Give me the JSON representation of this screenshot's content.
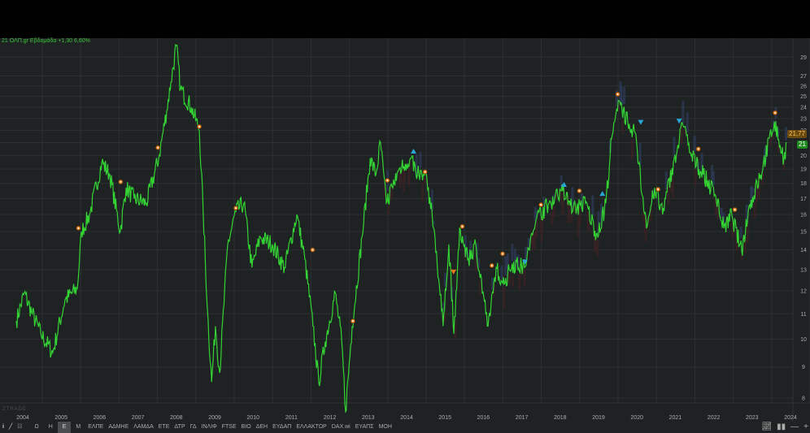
{
  "legend": {
    "text": "21 ΟΛΠ.gr Εβδομάδα +1,30 6,60%"
  },
  "watermark": "ZTRADE",
  "price_tags": {
    "last_close": "21,77",
    "current": "21"
  },
  "toolbar": {
    "tools": [
      "i-icon",
      "line-tool-icon",
      "grid-icon"
    ],
    "intervals": [
      "Ω",
      "Η",
      "Ε",
      "Μ"
    ],
    "active_interval": "Ε",
    "symbols": [
      "ΕΛΠΕ",
      "ΑΔΜΗΕ",
      "ΛΑΜΔΑ",
      "ΕΤΕ",
      "ΔΤΡ",
      "ΓΔ",
      "ΙΝΛΙΦ",
      "FTSE",
      "ΒΙΟ",
      "ΔΕΗ",
      "ΕΥΔΑΠ",
      "ΕΛΛΑΚΤΩΡ",
      "DAX.wi",
      "ΕΥΑΠΣ",
      "ΜΟΗ"
    ],
    "right": [
      "indicators-icon",
      "volume-icon",
      "zoom-out-icon",
      "zoom-in-icon"
    ]
  },
  "colors": {
    "line": "#33d433",
    "grid": "#2f3334",
    "bg": "#1f2223",
    "marker_orange": "#e07b1f",
    "marker_blue": "#2aa6d6"
  },
  "chart_data": {
    "type": "line",
    "title": "ΟΛΠ.gr Εβδομάδα",
    "xlabel": "",
    "ylabel": "",
    "y_scale": "log",
    "ylim": [
      7.3,
      31
    ],
    "xlim": [
      2003.65,
      2024.15
    ],
    "x_ticks": [
      "2004",
      "2005",
      "2006",
      "2007",
      "2008",
      "2009",
      "2010",
      "2011",
      "2012",
      "2013",
      "2014",
      "2015",
      "2016",
      "2017",
      "2018",
      "2019",
      "2020",
      "2021",
      "2022",
      "2023",
      "2024"
    ],
    "y_ticks": [
      8,
      9,
      10,
      11,
      12,
      13,
      14,
      15,
      16,
      17,
      18,
      19,
      20,
      21,
      22,
      23,
      24,
      25,
      26,
      27,
      29
    ],
    "grid": true,
    "series": [
      {
        "name": "ΟΛΠ",
        "points": [
          [
            2003.83,
            10.7
          ],
          [
            2004.04,
            11.9
          ],
          [
            2004.25,
            11.0
          ],
          [
            2004.47,
            10.2
          ],
          [
            2004.78,
            9.5
          ],
          [
            2005.1,
            11.6
          ],
          [
            2005.42,
            12.1
          ],
          [
            2005.53,
            15
          ],
          [
            2005.74,
            16
          ],
          [
            2006.06,
            19.5
          ],
          [
            2006.27,
            18.6
          ],
          [
            2006.54,
            15
          ],
          [
            2006.69,
            17.7
          ],
          [
            2006.9,
            17
          ],
          [
            2007.22,
            16.7
          ],
          [
            2007.54,
            19.8
          ],
          [
            2007.75,
            23.7
          ],
          [
            2007.86,
            26.4
          ],
          [
            2008.0,
            30.3
          ],
          [
            2008.11,
            25.7
          ],
          [
            2008.39,
            24
          ],
          [
            2008.6,
            22
          ],
          [
            2008.7,
            16.2
          ],
          [
            2008.81,
            11.2
          ],
          [
            2008.92,
            8.5
          ],
          [
            2009.02,
            10.5
          ],
          [
            2009.13,
            8.8
          ],
          [
            2009.34,
            14.3
          ],
          [
            2009.55,
            16.2
          ],
          [
            2009.76,
            16.7
          ],
          [
            2009.97,
            13.1
          ],
          [
            2010.19,
            14.7
          ],
          [
            2010.5,
            14.3
          ],
          [
            2010.82,
            13.1
          ],
          [
            2011.14,
            16
          ],
          [
            2011.35,
            13.5
          ],
          [
            2011.56,
            10.5
          ],
          [
            2011.71,
            8.5
          ],
          [
            2011.88,
            9.9
          ],
          [
            2012.14,
            11.9
          ],
          [
            2012.31,
            9.9
          ],
          [
            2012.41,
            7.6
          ],
          [
            2012.58,
            10.5
          ],
          [
            2012.84,
            14.7
          ],
          [
            2013.05,
            19.8
          ],
          [
            2013.2,
            18.6
          ],
          [
            2013.32,
            21
          ],
          [
            2013.47,
            16.7
          ],
          [
            2013.79,
            18.9
          ],
          [
            2014.1,
            19.8
          ],
          [
            2014.32,
            18.6
          ],
          [
            2014.53,
            18.3
          ],
          [
            2014.74,
            14.7
          ],
          [
            2014.95,
            10.5
          ],
          [
            2015.1,
            14.3
          ],
          [
            2015.23,
            10.2
          ],
          [
            2015.38,
            15.2
          ],
          [
            2015.59,
            13.5
          ],
          [
            2015.8,
            14.3
          ],
          [
            2016.12,
            10.5
          ],
          [
            2016.33,
            13.1
          ],
          [
            2016.54,
            12.3
          ],
          [
            2016.75,
            13.3
          ],
          [
            2017.07,
            13.1
          ],
          [
            2017.39,
            15.8
          ],
          [
            2017.71,
            16.7
          ],
          [
            2018.03,
            17.5
          ],
          [
            2018.34,
            16.4
          ],
          [
            2018.66,
            16.7
          ],
          [
            2018.98,
            14.7
          ],
          [
            2019.19,
            16.7
          ],
          [
            2019.34,
            21.3
          ],
          [
            2019.55,
            24.5
          ],
          [
            2019.76,
            22.7
          ],
          [
            2019.97,
            21.7
          ],
          [
            2020.14,
            17.2
          ],
          [
            2020.25,
            15.2
          ],
          [
            2020.46,
            17.7
          ],
          [
            2020.67,
            16
          ],
          [
            2020.95,
            19.5
          ],
          [
            2021.2,
            22.4
          ],
          [
            2021.41,
            20
          ],
          [
            2021.73,
            18.6
          ],
          [
            2022.05,
            17.2
          ],
          [
            2022.26,
            15.2
          ],
          [
            2022.47,
            16
          ],
          [
            2022.73,
            13.9
          ],
          [
            2022.9,
            16.2
          ],
          [
            2023.22,
            18.6
          ],
          [
            2023.58,
            22.7
          ],
          [
            2023.73,
            20.8
          ],
          [
            2023.83,
            19.8
          ],
          [
            2023.9,
            21
          ]
        ]
      }
    ],
    "markers": [
      {
        "type": "circle",
        "x": 2005.45,
        "y": 15.2
      },
      {
        "type": "circle",
        "x": 2006.55,
        "y": 18.1
      },
      {
        "type": "circle",
        "x": 2007.52,
        "y": 20.6
      },
      {
        "type": "circle",
        "x": 2008.6,
        "y": 22.3
      },
      {
        "type": "circle",
        "x": 2009.55,
        "y": 16.4
      },
      {
        "type": "circle",
        "x": 2011.55,
        "y": 14
      },
      {
        "type": "circle",
        "x": 2012.6,
        "y": 10.7
      },
      {
        "type": "circle",
        "x": 2013.5,
        "y": 18.2
      },
      {
        "type": "triangle-up",
        "x": 2014.18,
        "y": 20.3
      },
      {
        "type": "circle",
        "x": 2014.48,
        "y": 18.8
      },
      {
        "type": "triangle-down",
        "x": 2015.22,
        "y": 12.9
      },
      {
        "type": "circle",
        "x": 2015.45,
        "y": 15.3
      },
      {
        "type": "circle",
        "x": 2016.22,
        "y": 13.2
      },
      {
        "type": "circle",
        "x": 2016.5,
        "y": 13.8
      },
      {
        "type": "triangle-down",
        "x": 2017.08,
        "y": 13.4
      },
      {
        "type": "circle",
        "x": 2017.5,
        "y": 16.6
      },
      {
        "type": "triangle-up",
        "x": 2018.1,
        "y": 17.9
      },
      {
        "type": "circle",
        "x": 2018.5,
        "y": 17.5
      },
      {
        "type": "triangle-up",
        "x": 2019.1,
        "y": 17.3
      },
      {
        "type": "circle",
        "x": 2019.5,
        "y": 25.2
      },
      {
        "type": "triangle-down",
        "x": 2020.1,
        "y": 22.7
      },
      {
        "type": "circle",
        "x": 2020.55,
        "y": 17.6
      },
      {
        "type": "triangle-down",
        "x": 2021.1,
        "y": 22.8
      },
      {
        "type": "circle",
        "x": 2021.6,
        "y": 20.5
      },
      {
        "type": "circle",
        "x": 2022.55,
        "y": 16.3
      },
      {
        "type": "circle",
        "x": 2023.6,
        "y": 23.5
      }
    ]
  }
}
